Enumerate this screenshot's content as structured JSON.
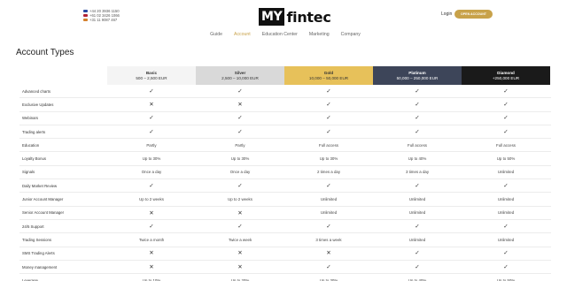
{
  "header": {
    "phones": [
      {
        "number": "+44 20 3936 1150",
        "flag_color": "#2b4aa0"
      },
      {
        "number": "+61 02 3426 1066",
        "flag_color": "#b22234"
      },
      {
        "number": "+31 11 9087 467",
        "flag_color": "#d4802c"
      }
    ],
    "logo_box": "MY",
    "logo_rest": "fintec",
    "login_label": "Login",
    "open_account_label": "OPEN ACCOUNT",
    "nav": [
      {
        "label": "Guide",
        "active": false
      },
      {
        "label": "Account",
        "active": true
      },
      {
        "label": "Education Center",
        "active": false
      },
      {
        "label": "Marketing",
        "active": false
      },
      {
        "label": "Company",
        "active": false
      }
    ]
  },
  "page_title": "Account Types",
  "plans": [
    {
      "key": "basic",
      "name": "Basic",
      "range": "500 – 2,500 EUR"
    },
    {
      "key": "silver",
      "name": "Silver",
      "range": "2,500 – 10,000 EUR"
    },
    {
      "key": "gold",
      "name": "Gold",
      "range": "10,000 – 50,000 EUR"
    },
    {
      "key": "platinum",
      "name": "Platinum",
      "range": "50,000 – 250,000 EUR"
    },
    {
      "key": "diamond",
      "name": "Diamond",
      "range": "+250,000 EUR"
    }
  ],
  "rows": [
    {
      "label": "Advanced charts",
      "values": [
        "check",
        "check",
        "check",
        "check",
        "check"
      ]
    },
    {
      "label": "Exclusive Updates",
      "values": [
        "cross",
        "cross",
        "check",
        "check",
        "check"
      ]
    },
    {
      "label": "Webinars",
      "values": [
        "check",
        "check",
        "check",
        "check",
        "check"
      ]
    },
    {
      "label": "Trading alerts",
      "values": [
        "check",
        "check",
        "check",
        "check",
        "check"
      ]
    },
    {
      "label": "Education",
      "values": [
        "Partly",
        "Partly",
        "Full access",
        "Full access",
        "Full access"
      ]
    },
    {
      "label": "Loyalty Bonus",
      "values": [
        "Up to 30%",
        "Up to 30%",
        "Up to 30%",
        "Up to 40%",
        "Up to 50%"
      ]
    },
    {
      "label": "Signals",
      "values": [
        "Once a day",
        "Once a day",
        "2 times a day",
        "3 times a day",
        "Unlimited"
      ]
    },
    {
      "label": "Daily Market Review",
      "values": [
        "check",
        "check",
        "check",
        "check",
        "check"
      ]
    },
    {
      "label": "Junior Account Manager",
      "values": [
        "Up to 2 weeks",
        "Up to 2 weeks",
        "Unlimited",
        "Unlimited",
        "Unlimited"
      ]
    },
    {
      "label": "Senior Account Manager",
      "values": [
        "cross",
        "cross",
        "Unlimited",
        "Unlimited",
        "Unlimited"
      ]
    },
    {
      "label": "24/5 Support",
      "values": [
        "check",
        "check",
        "check",
        "check",
        "check"
      ]
    },
    {
      "label": "Trading Sessions",
      "values": [
        "Twice a month",
        "Twice a week",
        "3 times a week",
        "Unlimited",
        "Unlimited"
      ]
    },
    {
      "label": "SMS Trading Alerts",
      "values": [
        "cross",
        "cross",
        "cross",
        "check",
        "check"
      ]
    },
    {
      "label": "Money management",
      "values": [
        "cross",
        "cross",
        "check",
        "check",
        "check"
      ]
    },
    {
      "label": "Leverage",
      "values": [
        "Up to 10%",
        "Up to 20%",
        "Up to 30%",
        "Up to 40%",
        "Up to 50%"
      ]
    }
  ],
  "symbols": {
    "check": "✓",
    "cross": "✕"
  }
}
